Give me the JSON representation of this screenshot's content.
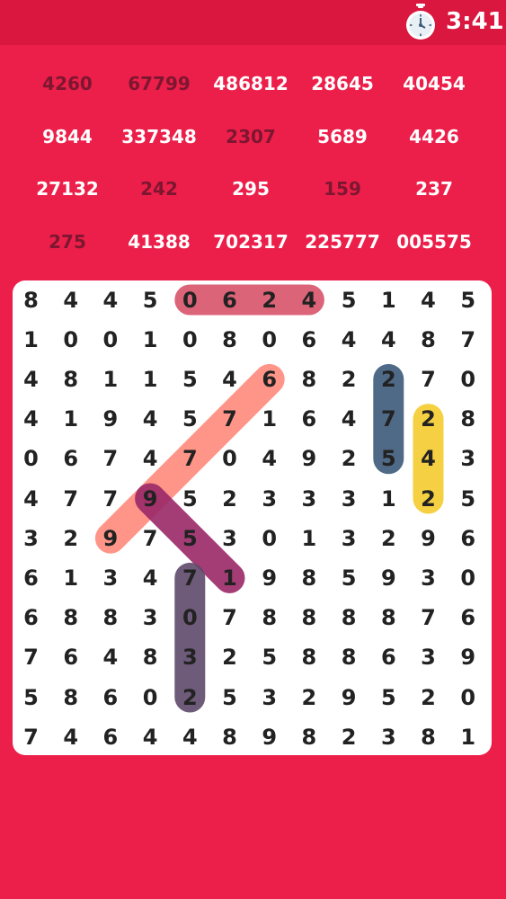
{
  "timer": {
    "icon": "stopwatch-icon",
    "time": "3:41"
  },
  "words": [
    {
      "text": "4260",
      "found": true
    },
    {
      "text": "67799",
      "found": true
    },
    {
      "text": "486812",
      "found": false
    },
    {
      "text": "28645",
      "found": false
    },
    {
      "text": "40454",
      "found": false
    },
    {
      "text": "9844",
      "found": false
    },
    {
      "text": "337348",
      "found": false
    },
    {
      "text": "2307",
      "found": true
    },
    {
      "text": "5689",
      "found": false
    },
    {
      "text": "4426",
      "found": false
    },
    {
      "text": "27132",
      "found": false
    },
    {
      "text": "242",
      "found": true
    },
    {
      "text": "295",
      "found": false
    },
    {
      "text": "159",
      "found": true
    },
    {
      "text": "237",
      "found": false
    },
    {
      "text": "275",
      "found": true
    },
    {
      "text": "41388",
      "found": false
    },
    {
      "text": "702317",
      "found": false
    },
    {
      "text": "225777",
      "found": false
    },
    {
      "text": "005575",
      "found": false
    }
  ],
  "grid": [
    [
      "8",
      "4",
      "4",
      "5",
      "0",
      "6",
      "2",
      "4",
      "5",
      "1",
      "4",
      "5"
    ],
    [
      "1",
      "0",
      "0",
      "1",
      "0",
      "8",
      "0",
      "6",
      "4",
      "4",
      "8",
      "7"
    ],
    [
      "4",
      "8",
      "1",
      "1",
      "5",
      "4",
      "6",
      "8",
      "2",
      "2",
      "7",
      "0"
    ],
    [
      "4",
      "1",
      "9",
      "4",
      "5",
      "7",
      "1",
      "6",
      "4",
      "7",
      "2",
      "8"
    ],
    [
      "0",
      "6",
      "7",
      "4",
      "7",
      "0",
      "4",
      "9",
      "2",
      "5",
      "4",
      "3"
    ],
    [
      "4",
      "7",
      "7",
      "9",
      "5",
      "2",
      "3",
      "3",
      "3",
      "1",
      "2",
      "5"
    ],
    [
      "3",
      "2",
      "9",
      "7",
      "5",
      "3",
      "0",
      "1",
      "3",
      "2",
      "9",
      "6"
    ],
    [
      "6",
      "1",
      "3",
      "4",
      "7",
      "1",
      "9",
      "8",
      "5",
      "9",
      "3",
      "0"
    ],
    [
      "6",
      "8",
      "8",
      "3",
      "0",
      "7",
      "8",
      "8",
      "8",
      "8",
      "7",
      "6"
    ],
    [
      "7",
      "6",
      "4",
      "8",
      "3",
      "2",
      "5",
      "8",
      "8",
      "6",
      "3",
      "9"
    ],
    [
      "5",
      "8",
      "6",
      "0",
      "2",
      "5",
      "3",
      "2",
      "9",
      "5",
      "2",
      "0"
    ],
    [
      "7",
      "4",
      "6",
      "4",
      "4",
      "8",
      "9",
      "8",
      "2",
      "3",
      "8",
      "1"
    ]
  ],
  "found_highlights": [
    {
      "word": "0624",
      "start": [
        0,
        4
      ],
      "end": [
        0,
        7
      ],
      "color": "#d9546a"
    },
    {
      "word": "67799",
      "start": [
        2,
        6
      ],
      "end": [
        6,
        2
      ],
      "color": "#ff8a7c"
    },
    {
      "word": "275",
      "start": [
        2,
        9
      ],
      "end": [
        4,
        9
      ],
      "color": "#3d5a7a"
    },
    {
      "word": "242",
      "start": [
        3,
        10
      ],
      "end": [
        5,
        10
      ],
      "color": "#f5cc2e"
    },
    {
      "word": "951",
      "start": [
        5,
        3
      ],
      "end": [
        7,
        5
      ],
      "color": "#9b2868"
    },
    {
      "word": "7032",
      "start": [
        7,
        4
      ],
      "end": [
        10,
        4
      ],
      "color": "#5e4a6b"
    }
  ]
}
